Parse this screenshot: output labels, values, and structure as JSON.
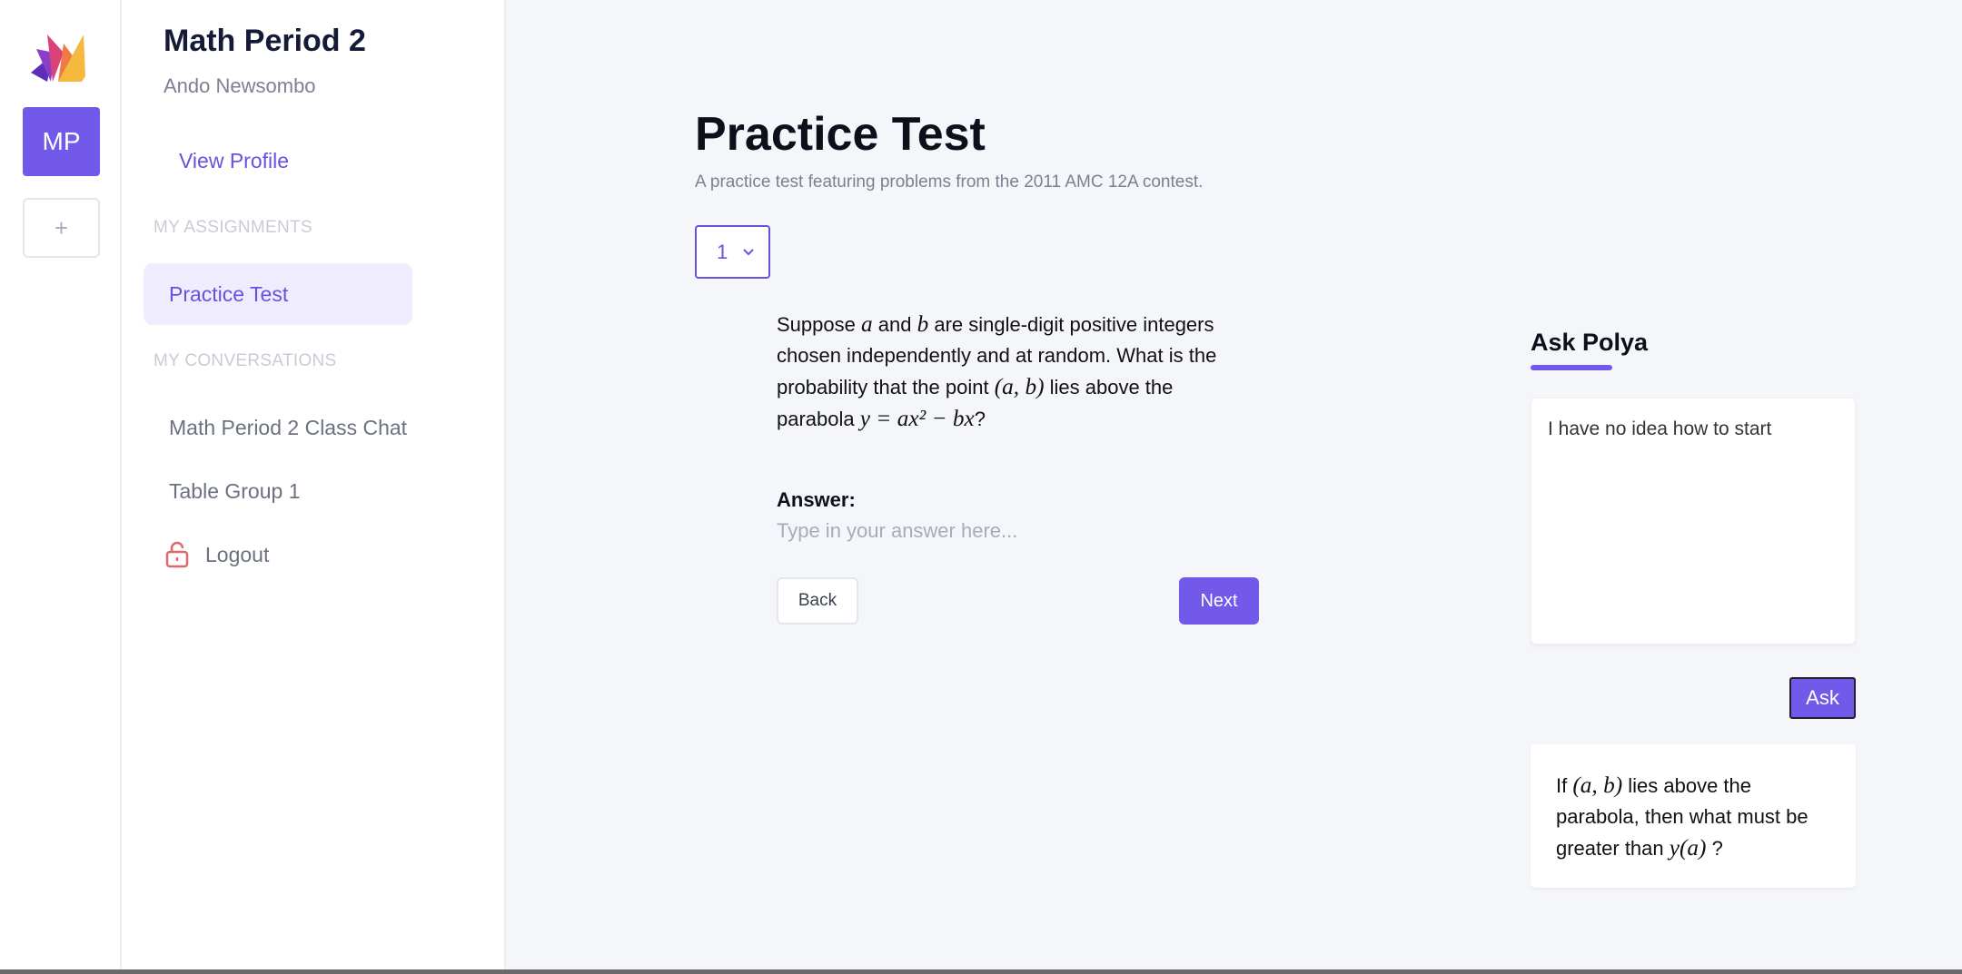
{
  "rail": {
    "class_initials": "MP",
    "add_symbol": "+",
    "logo_icon": "polya-logo-icon",
    "colors": {
      "accent": "#7259ea"
    }
  },
  "sidebar": {
    "class_title": "Math Period 2",
    "teacher_name": "Ando Newsombo",
    "view_profile": "View Profile",
    "assignments_label": "MY ASSIGNMENTS",
    "assignments": [
      {
        "label": "Practice Test"
      }
    ],
    "conversations_label": "MY CONVERSATIONS",
    "conversations": [
      {
        "label": "Math Period 2 Class Chat"
      },
      {
        "label": "Table Group 1"
      }
    ],
    "logout_label": "Logout",
    "logout_icon": "unlock-icon"
  },
  "main": {
    "title": "Practice Test",
    "subtitle": "A practice test featuring problems from the 2011 AMC 12A contest.",
    "question_number": "1",
    "problem": {
      "t1": "Suppose ",
      "m1": "a",
      "t2": " and ",
      "m2": "b",
      "t3": " are single-digit positive integers chosen independently and at random. What is the probability that the point ",
      "m3": "(a, b)",
      "t4": " lies above the parabola ",
      "m4": "y = ax² − bx",
      "t5": "?"
    },
    "answer_label": "Answer:",
    "answer_placeholder": "Type in your answer here...",
    "back_label": "Back",
    "next_label": "Next"
  },
  "polya": {
    "title": "Ask Polya",
    "input_value": "I have no idea how to start",
    "ask_label": "Ask",
    "response": {
      "t1": "If ",
      "m1": "(a, b)",
      "t2": " lies above the parabola, then what must be greater than ",
      "m2": "y(a)",
      "t3": " ?"
    }
  }
}
